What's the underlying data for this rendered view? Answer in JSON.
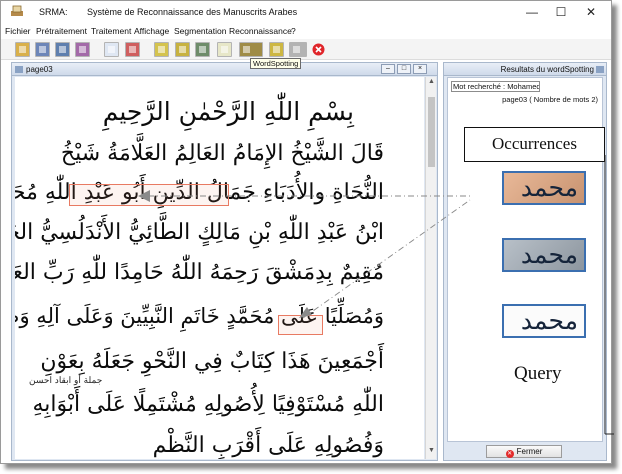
{
  "app": {
    "short_name": "SRMA:",
    "full_name": "Système de Reconnaissance des Manuscrits Arabes",
    "window_controls": [
      "—",
      "☐",
      "✕"
    ]
  },
  "menu": [
    "Fichier",
    "Prétraitement",
    "Traitement",
    "Affichage",
    "Segmentation",
    "Reconnaissance",
    "?"
  ],
  "toolbar": {
    "buttons": [
      {
        "name": "open-folder-icon",
        "color": "#d9b04a"
      },
      {
        "name": "save-icon",
        "color": "#6d86b8"
      },
      {
        "name": "document-stack-icon",
        "color": "#5f7fae"
      },
      {
        "name": "print-icon",
        "color": "#a36aa8"
      },
      {
        "name": "page-icon",
        "color": "#dfe7f3"
      },
      {
        "name": "image-page-icon",
        "color": "#cf5f5f"
      },
      {
        "name": "layout-icon",
        "color": "#d4c34e"
      },
      {
        "name": "segment-icon",
        "color": "#c7b240"
      },
      {
        "name": "picture-icon",
        "color": "#6e8c6a"
      },
      {
        "name": "page-text-icon",
        "color": "#e7e7c8"
      },
      {
        "name": "book-icon",
        "color": "#9f8c46"
      },
      {
        "name": "help-icon",
        "color": "#cdb742"
      },
      {
        "name": "blank-icon",
        "color": "#b3b3b3"
      }
    ],
    "stop_icon_color": "#e0262b",
    "tooltip": "WordSpotting"
  },
  "document_panel": {
    "title": "page03",
    "lines": [
      "بِسْمِ اللّٰهِ الرَّحْمٰنِ الرَّحِيمِ",
      "قَالَ الشَّيْخُ الإِمَامُ العَالِمُ العَلَّامَةُ شَيْخُ",
      "النُّحَاةِ والأُدَبَاءِ جَمَالُ الدِّينِ أَبُو عَبْدِ اللّٰهِ مُحَمَّدُ",
      "ابْنُ عَبْدِ اللّٰهِ بْنِ مَالِكٍ الطَّائِيُّ الأَنْدَلُسِيُّ الجَيَّانِيُّ",
      "مُقِيمٌ بِدِمَشْقَ رَحِمَهُ اللّٰهُ حَامِدًا للّٰهِ رَبِّ العَالَمِينَ",
      "وَمُصَلِّيًا عَلَى مُحَمَّدٍ خَاتَمِ النَّبِيِّينَ وَعَلَى آلِهِ وَصَحَابَتِهِ",
      "أَجْمَعِينَ هَذَا كِتَابٌ فِي النَّحْوِ جَعَلَهُ بِعَوْنِ",
      "اللّٰهِ مُسْتَوْفِيًا لِأُصُولِهِ مُشْتَمِلًا عَلَى أَبْوَابِهِ",
      "وَفُصُولِهِ عَلَى أَقْرَبِ النَّظْمِ"
    ],
    "margin_note": "جملة أو ابقاد احسن"
  },
  "results_panel": {
    "title": "Resultats du wordSpotting",
    "query_label": "Mot recherché : Mohamed",
    "page_info": "page03 ( Nombre de mots 2)",
    "close_button": "Fermer",
    "word_images": [
      "محمد",
      "محمد",
      "محمد"
    ]
  },
  "annotations": {
    "occurrences_label": "Occurrences",
    "query_label": "Query"
  }
}
